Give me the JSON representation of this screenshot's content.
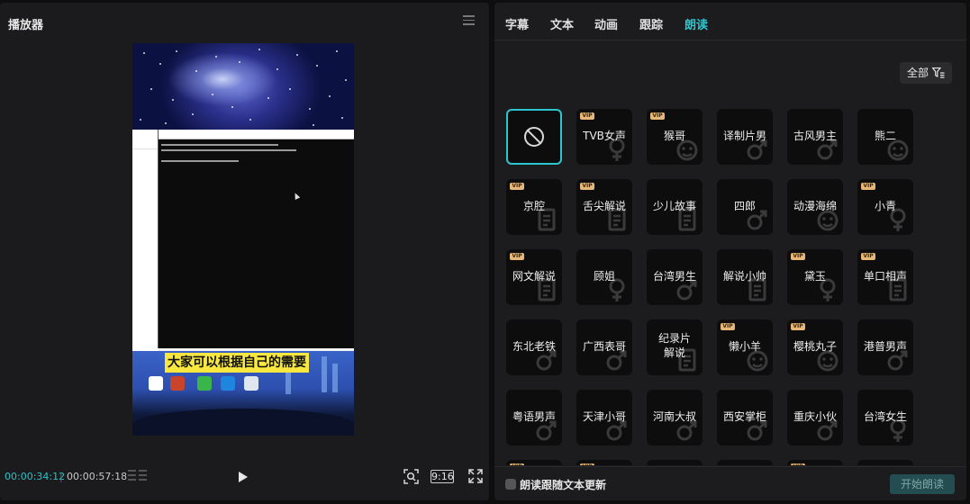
{
  "player": {
    "title": "播放器",
    "menu_icon": "hamburger-icon",
    "subtitle": "大家可以根据自己的需要",
    "time_current": "00:00:34:12",
    "time_separator": "|",
    "time_total": "00:00:57:18",
    "ratio": "9:16",
    "icons": [
      "timeline-bars-icon",
      "play-icon",
      "fit-view-icon",
      "fullscreen-icon"
    ]
  },
  "panel": {
    "tabs": [
      {
        "label": "字幕"
      },
      {
        "label": "文本"
      },
      {
        "label": "动画"
      },
      {
        "label": "跟踪"
      },
      {
        "label": "朗读",
        "active": true
      }
    ],
    "filter_label": "全部",
    "filter_icon": "filter-icon",
    "accent_color": "#2cc6cf",
    "vip_badge": "VIP",
    "voices": [
      {
        "label": "",
        "type": "none",
        "selected": true
      },
      {
        "label": "TVB女声",
        "vip": true,
        "gender": "female"
      },
      {
        "label": "猴哥",
        "vip": true,
        "gender": "face"
      },
      {
        "label": "译制片男",
        "vip": false,
        "gender": "male"
      },
      {
        "label": "古风男主",
        "vip": false,
        "gender": "male"
      },
      {
        "label": "熊二",
        "vip": false,
        "gender": "face"
      },
      {
        "label": "京腔",
        "vip": true,
        "gender": "doc"
      },
      {
        "label": "舌尖解说",
        "vip": true,
        "gender": "doc"
      },
      {
        "label": "少儿故事",
        "vip": false,
        "gender": "doc"
      },
      {
        "label": "四郎",
        "vip": false,
        "gender": "male"
      },
      {
        "label": "动漫海绵",
        "vip": false,
        "gender": "face"
      },
      {
        "label": "小青",
        "vip": true,
        "gender": "female"
      },
      {
        "label": "网文解说",
        "vip": true,
        "gender": "doc"
      },
      {
        "label": "顾姐",
        "vip": false,
        "gender": "female"
      },
      {
        "label": "台湾男生",
        "vip": false,
        "gender": "male"
      },
      {
        "label": "解说小帅",
        "vip": false,
        "gender": "doc"
      },
      {
        "label": "黛玉",
        "vip": true,
        "gender": "female"
      },
      {
        "label": "单口相声",
        "vip": true,
        "gender": "doc"
      },
      {
        "label": "东北老铁",
        "vip": false,
        "gender": "male"
      },
      {
        "label": "广西表哥",
        "vip": false,
        "gender": "male"
      },
      {
        "label": "纪录片解说",
        "vip": false,
        "gender": "doc",
        "twoline": true
      },
      {
        "label": "懒小羊",
        "vip": true,
        "gender": "face"
      },
      {
        "label": "樱桃丸子",
        "vip": true,
        "gender": "face"
      },
      {
        "label": "港普男声",
        "vip": false,
        "gender": "male"
      },
      {
        "label": "粤语男声",
        "vip": false,
        "gender": "male"
      },
      {
        "label": "天津小哥",
        "vip": false,
        "gender": "male"
      },
      {
        "label": "河南大叔",
        "vip": false,
        "gender": "male"
      },
      {
        "label": "西安掌柜",
        "vip": false,
        "gender": "male"
      },
      {
        "label": "重庆小伙",
        "vip": false,
        "gender": "male"
      },
      {
        "label": "台湾女生",
        "vip": false,
        "gender": "female"
      },
      {
        "label": "",
        "vip": true,
        "gender": "doc"
      },
      {
        "label": "",
        "vip": true,
        "gender": "doc"
      },
      {
        "label": "",
        "vip": false,
        "gender": "doc"
      },
      {
        "label": "",
        "vip": false,
        "gender": "doc"
      },
      {
        "label": "",
        "vip": true,
        "gender": "doc"
      },
      {
        "label": "",
        "vip": false,
        "gender": "doc"
      }
    ],
    "footer": {
      "checkbox_label": "朗读跟随文本更新",
      "start_button": "开始朗读"
    }
  }
}
